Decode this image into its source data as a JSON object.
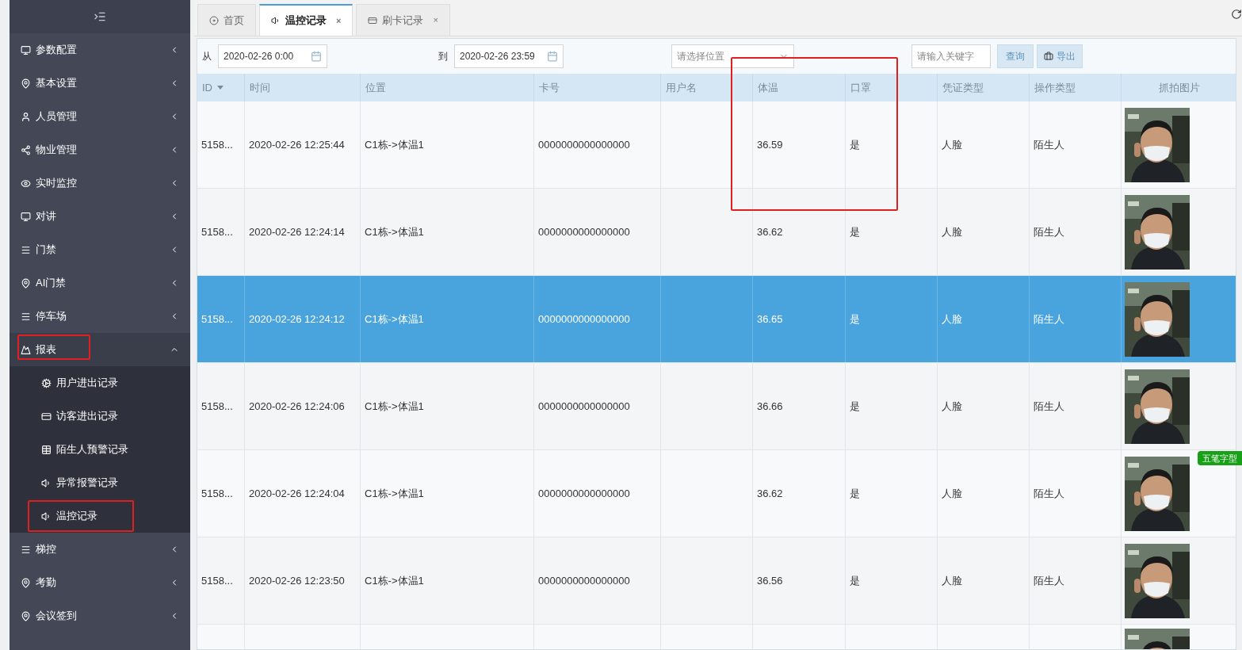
{
  "sidebar": {
    "items": [
      {
        "label": "参数配置",
        "expanded": false,
        "annotated": false
      },
      {
        "label": "基本设置",
        "expanded": false,
        "annotated": false
      },
      {
        "label": "人员管理",
        "expanded": false,
        "annotated": false
      },
      {
        "label": "物业管理",
        "expanded": false,
        "annotated": false
      },
      {
        "label": "实时监控",
        "expanded": false,
        "annotated": false
      },
      {
        "label": "对讲",
        "expanded": false,
        "annotated": false
      },
      {
        "label": "门禁",
        "expanded": false,
        "annotated": false
      },
      {
        "label": "AI门禁",
        "expanded": false,
        "annotated": false
      },
      {
        "label": "停车场",
        "expanded": false,
        "annotated": false
      },
      {
        "label": "报表",
        "expanded": true,
        "annotated": true,
        "children": [
          {
            "label": "用户进出记录",
            "annotated": false
          },
          {
            "label": "访客进出记录",
            "annotated": false
          },
          {
            "label": "陌生人预警记录",
            "annotated": false
          },
          {
            "label": "异常报警记录",
            "annotated": false
          },
          {
            "label": "温控记录",
            "annotated": true
          }
        ]
      },
      {
        "label": "梯控",
        "expanded": false,
        "annotated": false
      },
      {
        "label": "考勤",
        "expanded": false,
        "annotated": false
      },
      {
        "label": "会议签到",
        "expanded": false,
        "annotated": false
      }
    ]
  },
  "tabs": [
    {
      "label": "首页",
      "selected": false
    },
    {
      "label": "温控记录",
      "selected": true,
      "close": "×"
    },
    {
      "label": "刷卡记录",
      "selected": false,
      "close": "×"
    }
  ],
  "filters": {
    "from_label": "从",
    "from_value": "2020-02-26 0:00",
    "to_label": "到",
    "to_value": "2020-02-26 23:59",
    "location": {
      "placeholder": "请选择位置"
    },
    "keyword": {
      "placeholder": "请输入关键字"
    },
    "buttons": [
      "查询",
      "导出"
    ]
  },
  "table": {
    "annotation_frame": true,
    "columns": [
      "ID",
      "时间",
      "位置",
      "卡号",
      "用户名",
      "体温",
      "口罩",
      "凭证类型",
      "操作类型",
      "抓拍图片"
    ],
    "rows": [
      {
        "selected": false,
        "cells": [
          "5158...",
          "2020-02-26 12:25:44",
          "C1栋->体温1",
          "0000000000000000",
          "",
          "36.59",
          "是",
          "人脸",
          "陌生人"
        ],
        "photo": {
          "kind": "picture"
        }
      },
      {
        "selected": false,
        "cells": [
          "5158...",
          "2020-02-26 12:24:14",
          "C1栋->体温1",
          "0000000000000000",
          "",
          "36.62",
          "是",
          "人脸",
          "陌生人"
        ],
        "photo": {
          "kind": "picture"
        }
      },
      {
        "selected": true,
        "cells": [
          "5158...",
          "2020-02-26 12:24:12",
          "C1栋->体温1",
          "0000000000000000",
          "",
          "36.65",
          "是",
          "人脸",
          "陌生人"
        ],
        "photo": {
          "kind": "picture"
        }
      },
      {
        "selected": false,
        "cells": [
          "5158...",
          "2020-02-26 12:24:06",
          "C1栋->体温1",
          "0000000000000000",
          "",
          "36.66",
          "是",
          "人脸",
          "陌生人"
        ],
        "photo": {
          "kind": "picture"
        }
      },
      {
        "selected": false,
        "cells": [
          "5158...",
          "2020-02-26 12:24:04",
          "C1栋->体温1",
          "0000000000000000",
          "",
          "36.62",
          "是",
          "人脸",
          "陌生人"
        ],
        "photo": {
          "kind": "picture"
        }
      },
      {
        "selected": false,
        "cells": [
          "5158...",
          "2020-02-26 12:23:50",
          "C1栋->体温1",
          "0000000000000000",
          "",
          "36.56",
          "是",
          "人脸",
          "陌生人"
        ],
        "photo": {
          "kind": "picture"
        }
      }
    ]
  },
  "ime_toolbar": {
    "label": "五笔字型"
  }
}
